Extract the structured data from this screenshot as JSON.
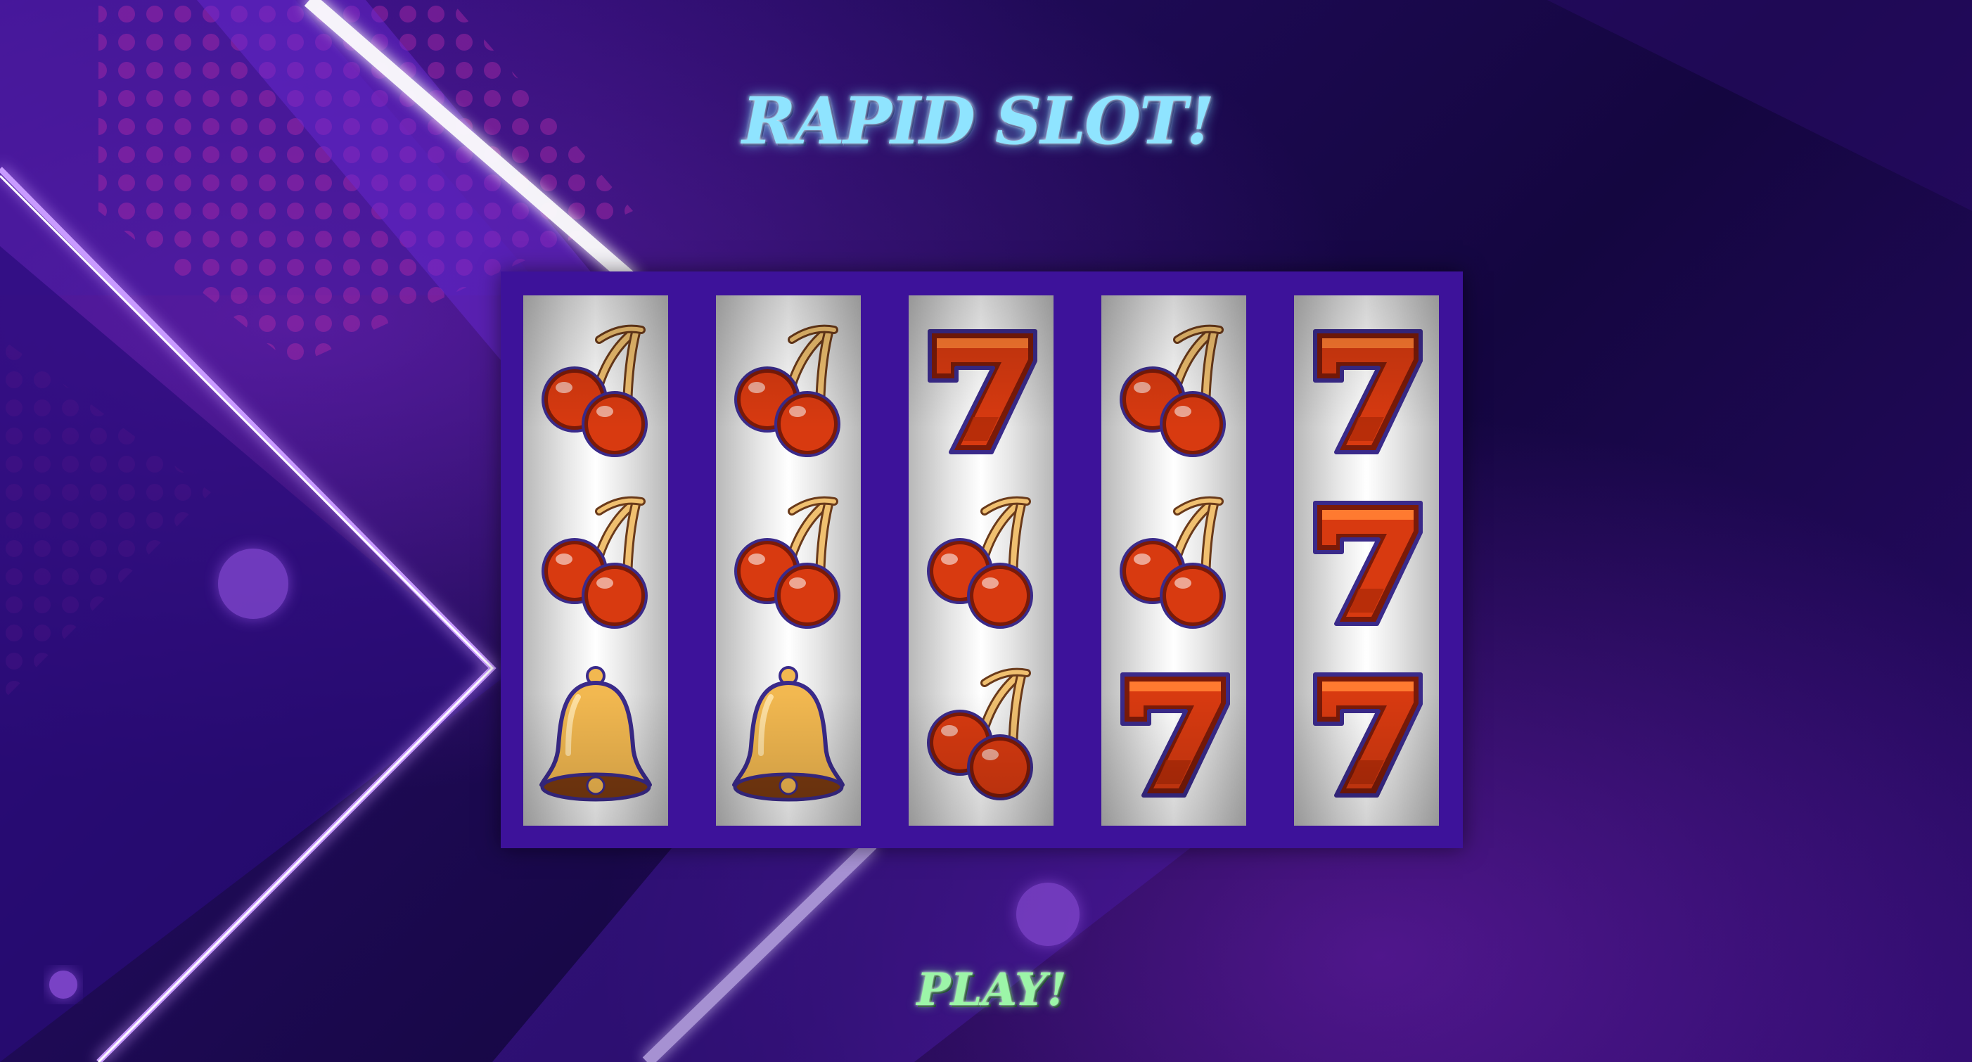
{
  "title": "RAPID SLOT!",
  "play_label": "PLAY!",
  "colors": {
    "frame": "#3d129a",
    "title": "#8fe4ff",
    "play": "#9cf5a8",
    "cherry": "#d83a10",
    "seven": "#d83a10",
    "bell": "#f2b850"
  },
  "reels": [
    [
      "cherry",
      "cherry",
      "bell"
    ],
    [
      "cherry",
      "cherry",
      "bell"
    ],
    [
      "seven",
      "cherry",
      "cherry"
    ],
    [
      "cherry",
      "cherry",
      "seven"
    ],
    [
      "seven",
      "seven",
      "seven"
    ]
  ]
}
